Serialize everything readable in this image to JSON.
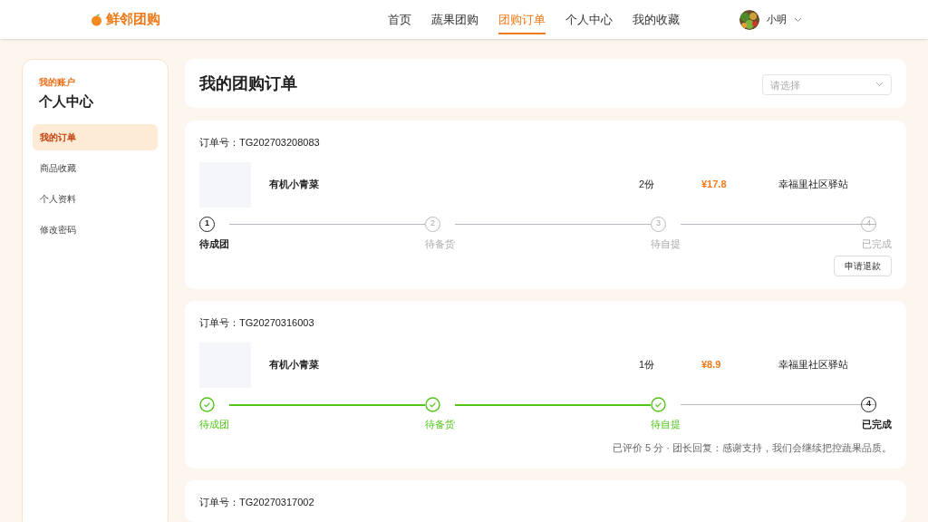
{
  "header": {
    "logo": "鲜邻团购",
    "nav": [
      {
        "label": "首页",
        "selected": false
      },
      {
        "label": "蔬果团购",
        "selected": false
      },
      {
        "label": "团购订单",
        "selected": true
      },
      {
        "label": "个人中心",
        "selected": false
      },
      {
        "label": "我的收藏",
        "selected": false
      }
    ],
    "user": "小明"
  },
  "sidebar": {
    "eyebrow": "我的账户",
    "title": "个人中心",
    "items": [
      {
        "label": "我的订单",
        "selected": true
      },
      {
        "label": "商品收藏",
        "selected": false
      },
      {
        "label": "个人资料",
        "selected": false
      },
      {
        "label": "修改密码",
        "selected": false
      }
    ]
  },
  "page": {
    "title": "我的团购订单",
    "filter": {
      "placeholder": "请选择"
    }
  },
  "orders": [
    {
      "order_label": "订单号：",
      "order_no": "TG202703208083",
      "product": "有机小青菜",
      "qty": "2份",
      "price": "¥17.8",
      "pickup": "幸福里社区驿站",
      "steps": [
        {
          "num": "1",
          "label": "待成团",
          "done": false,
          "current": true
        },
        {
          "num": "2",
          "label": "待备货",
          "done": false,
          "current": false
        },
        {
          "num": "3",
          "label": "待自提",
          "done": false,
          "current": false
        },
        {
          "num": "4",
          "label": "已完成",
          "done": false,
          "current": false
        }
      ],
      "footer": {
        "kind": "button",
        "text": "申请退款"
      }
    },
    {
      "order_label": "订单号：",
      "order_no": "TG20270316003",
      "product": "有机小青菜",
      "qty": "1份",
      "price": "¥8.9",
      "pickup": "幸福里社区驿站",
      "steps": [
        {
          "label": "待成团",
          "done": true
        },
        {
          "label": "待备货",
          "done": true
        },
        {
          "label": "待自提",
          "done": true
        },
        {
          "num": "4",
          "label": "已完成",
          "done": false,
          "current": true
        }
      ],
      "footer": {
        "kind": "note",
        "text": "已评价 5 分 · 团长回复：感谢支持，我们会继续把控蔬果品质。"
      }
    },
    {
      "order_label": "订单号：",
      "order_no": "TG20270317002"
    }
  ]
}
